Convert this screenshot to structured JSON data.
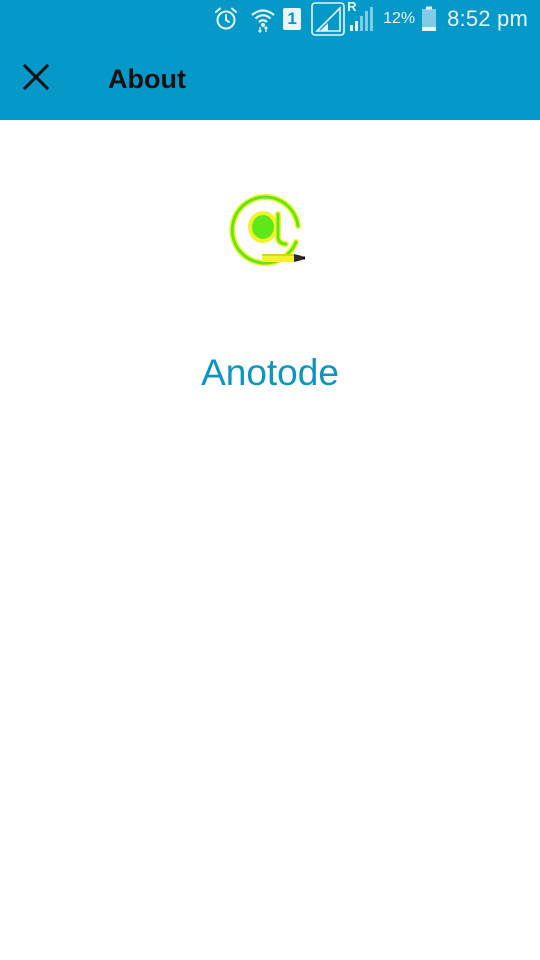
{
  "status_bar": {
    "sim_slot": "1",
    "roaming_indicator": "R",
    "battery_percent": "12%",
    "time": "8:52 pm",
    "icons": [
      "alarm-icon",
      "wifi-icon",
      "sim-1-icon",
      "signal-icon",
      "roaming-signal-icon",
      "battery-icon"
    ]
  },
  "toolbar": {
    "title": "About",
    "close_icon": "close-icon"
  },
  "content": {
    "app_logo_icon": "at-sign-highlighter-logo",
    "app_name": "Anotode"
  },
  "colors": {
    "primary": "#0499c9",
    "app_name_text": "#0b95c4",
    "logo_green": "#5ee81a",
    "logo_yellow": "#f6f02e"
  }
}
